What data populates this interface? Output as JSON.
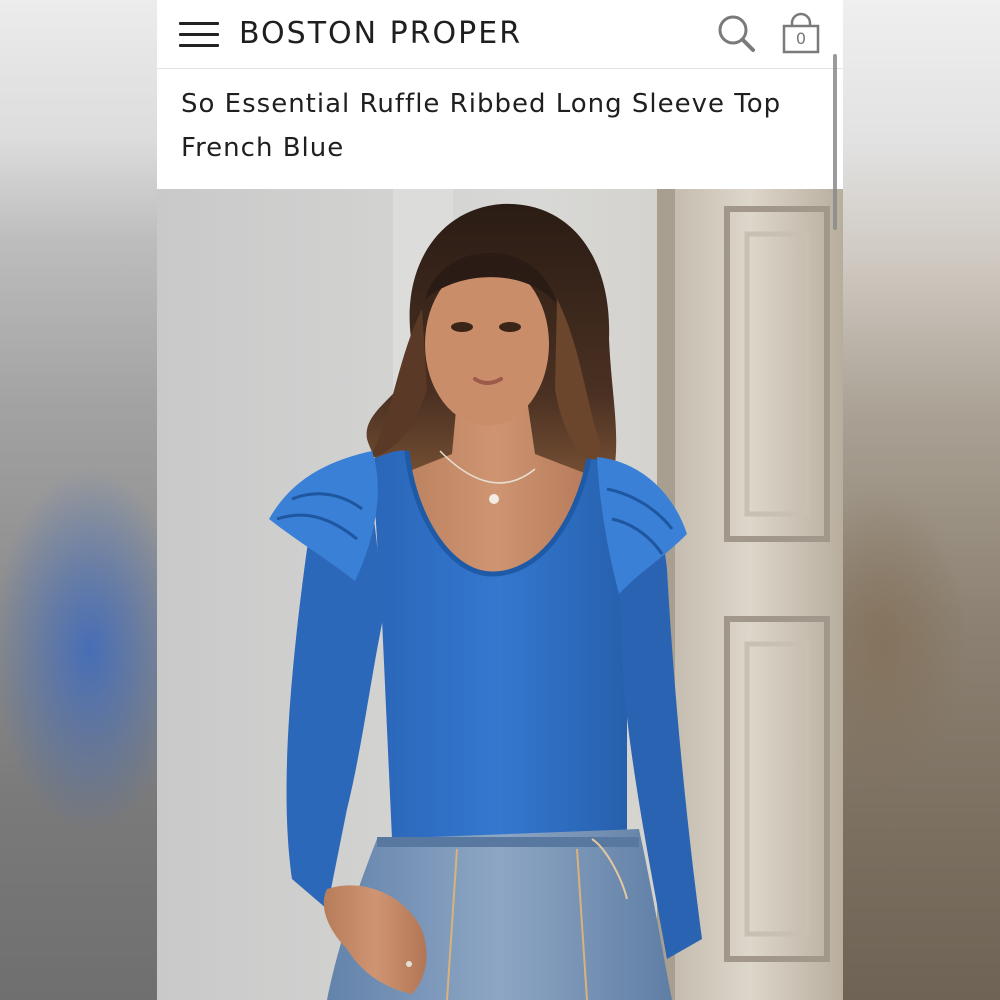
{
  "header": {
    "brand": "BOSTON PROPER",
    "menu_icon": "hamburger-menu-icon",
    "search_icon": "search-icon",
    "bag_icon": "shopping-bag-icon",
    "bag_count": "0"
  },
  "product": {
    "title": "So Essential Ruffle Ribbed Long Sleeve Top",
    "color": "French Blue",
    "image_subject": "model-wearing-blue-ruffle-top"
  },
  "colors": {
    "top_blue": "#2f6fc4",
    "denim": "#6f8fb4",
    "background": "#ffffff",
    "text": "#1f1f1f"
  }
}
